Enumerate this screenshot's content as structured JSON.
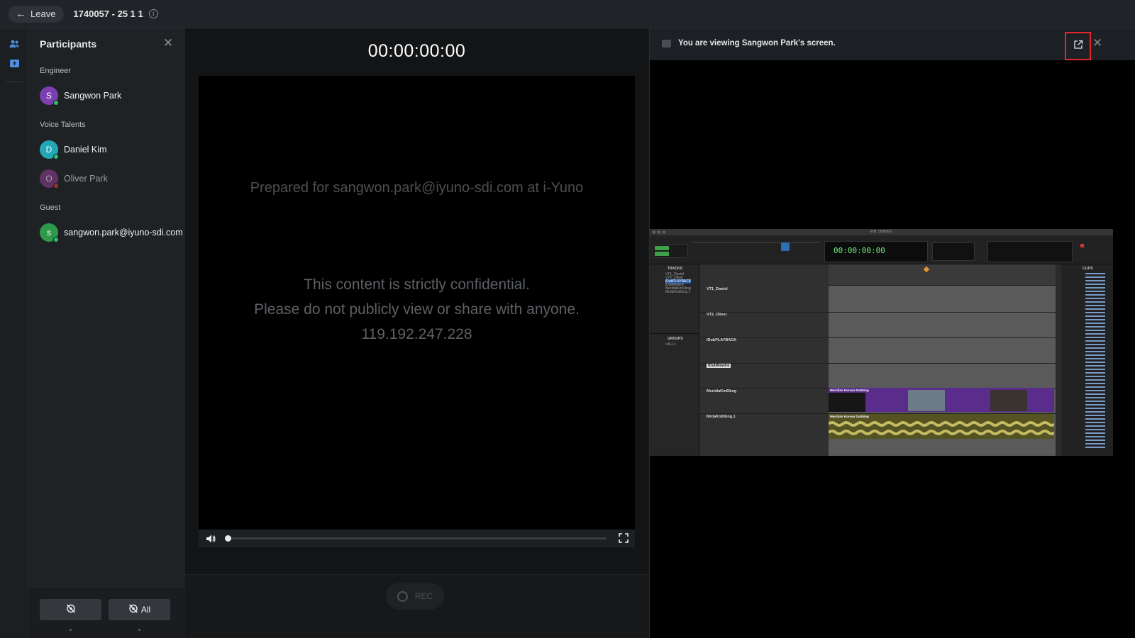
{
  "topbar": {
    "leave_label": "Leave",
    "session_title": "1740057 - 25 1 1"
  },
  "participants": {
    "title": "Participants",
    "groups": [
      {
        "label": "Engineer",
        "members": [
          {
            "initial": "S",
            "name": "Sangwon Park",
            "avatar_color": "#7b3fb0",
            "status_color": "#2fbf71"
          }
        ]
      },
      {
        "label": "Voice Talents",
        "members": [
          {
            "initial": "D",
            "name": "Daniel Kim",
            "avatar_color": "#23a7b7",
            "status_color": "#2fbf71"
          },
          {
            "initial": "O",
            "name": "Oliver Park",
            "avatar_color": "#8e3e8f",
            "status_color": "#e0413b"
          }
        ]
      },
      {
        "label": "Guest",
        "members": [
          {
            "initial": "s",
            "name": "sangwon.park@iyuno-sdi.com",
            "avatar_color": "#2f9a4a",
            "status_color": "#2fbf71"
          }
        ]
      }
    ],
    "footer": {
      "hide_label": "",
      "hide_all_label": "All"
    }
  },
  "player": {
    "timecode": "00:00:00:00",
    "prepared_for": "Prepared for sangwon.park@iyuno-sdi.com at i-Yuno",
    "confidential_lines": [
      "This content is strictly confidential.",
      "Please do not publicly view or share with anyone.",
      "119.192.247.228"
    ],
    "progress": 0.0,
    "rec_label": "REC"
  },
  "share": {
    "viewing_text": "You are viewing Sangwon Park's screen.",
    "daw": {
      "window_title": "Edit: Untitled1",
      "counter": "00:00:00:00",
      "tracks": [
        "VT1_Daniel",
        "VT2_Oliver",
        "iDubPLAYBACK",
        "iDubRewire",
        "MeridiaKmDbng",
        "MrdaKmDbng.1"
      ],
      "left_items": [
        "VT1_Daniel",
        "VT2_Oliver",
        "iDubPLAYBACK",
        "iDubRewire",
        "MeridiaKmDbng",
        "MrdaKmDbng.1"
      ],
      "tracks_header": "TRACKS",
      "groups_header": "GROUPS",
      "groups_item": "<ALL>",
      "clips_header": "CLIPS",
      "video_clip": "Meridian Korean Dubbing",
      "audio_clip": "Meridian Korean Dubbing"
    }
  },
  "colors": {
    "accent_red": "#e2262b",
    "online": "#2fbf71",
    "offline": "#e0413b"
  },
  "icons": {
    "leave": "arrow-left-icon",
    "info": "info-icon",
    "people": "people-icon",
    "screen-share": "screen-share-icon",
    "close": "close-icon",
    "volume": "volume-icon",
    "fullscreen": "fullscreen-icon",
    "popout": "popout-icon",
    "hide-video": "video-off-icon"
  }
}
